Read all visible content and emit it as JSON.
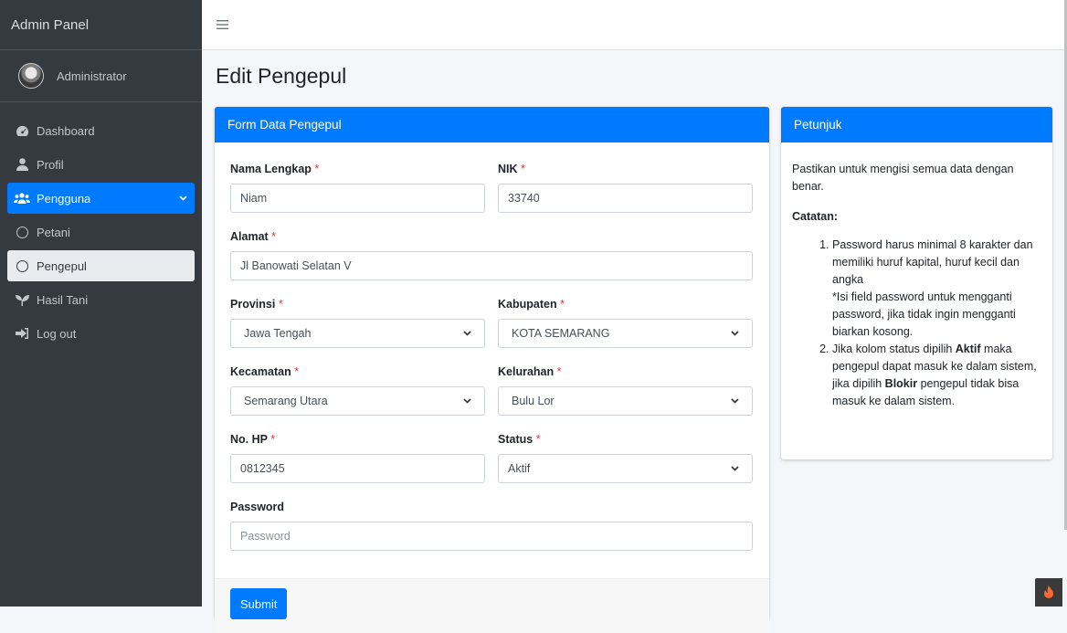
{
  "sidebar": {
    "brand": "Admin Panel",
    "user_name": "Administrator",
    "items": [
      {
        "label": "Dashboard",
        "icon": "tachometer-icon"
      },
      {
        "label": "Profil",
        "icon": "user-icon"
      },
      {
        "label": "Pengguna",
        "icon": "users-icon"
      },
      {
        "label": "Petani",
        "icon": "circle-icon"
      },
      {
        "label": "Pengepul",
        "icon": "circle-icon"
      },
      {
        "label": "Hasil Tani",
        "icon": "seedling-icon"
      },
      {
        "label": "Log out",
        "icon": "sign-out-icon"
      }
    ]
  },
  "page": {
    "title": "Edit Pengepul"
  },
  "form": {
    "header": "Form Data Pengepul",
    "required_mark": "*",
    "nama": {
      "label": "Nama Lengkap",
      "value": "Niam"
    },
    "nik": {
      "label": "NIK",
      "value": "33740"
    },
    "alamat": {
      "label": "Alamat",
      "value": "Jl Banowati Selatan V"
    },
    "provinsi": {
      "label": "Provinsi",
      "value": "Jawa Tengah"
    },
    "kabupaten": {
      "label": "Kabupaten",
      "value": "KOTA SEMARANG"
    },
    "kecamatan": {
      "label": "Kecamatan",
      "value": "Semarang Utara"
    },
    "kelurahan": {
      "label": "Kelurahan",
      "value": "Bulu Lor"
    },
    "hp": {
      "label": "No. HP",
      "value": "0812345"
    },
    "status": {
      "label": "Status",
      "value": "Aktif"
    },
    "password": {
      "label": "Password",
      "placeholder": "Password"
    },
    "submit_label": "Submit"
  },
  "hint": {
    "header": "Petunjuk",
    "intro": "Pastikan untuk mengisi semua data dengan benar.",
    "note_title": "Catatan:",
    "item1_main": "Password harus minimal 8 karakter dan memiliki huruf kapital, huruf kecil dan angka",
    "item1_sub": "*Isi field password untuk mengganti password, jika tidak ingin mengganti biarkan kosong.",
    "item2_a": "Jika kolom status dipilih ",
    "item2_b": "Aktif",
    "item2_c": " maka pengepul dapat masuk ke dalam sistem, jika dipilih ",
    "item2_d": "Blokir",
    "item2_e": " pengepul tidak bisa masuk ke dalam sistem."
  },
  "colors": {
    "primary": "#007bff",
    "sidebar": "#343a40",
    "required": "#dc3545"
  }
}
